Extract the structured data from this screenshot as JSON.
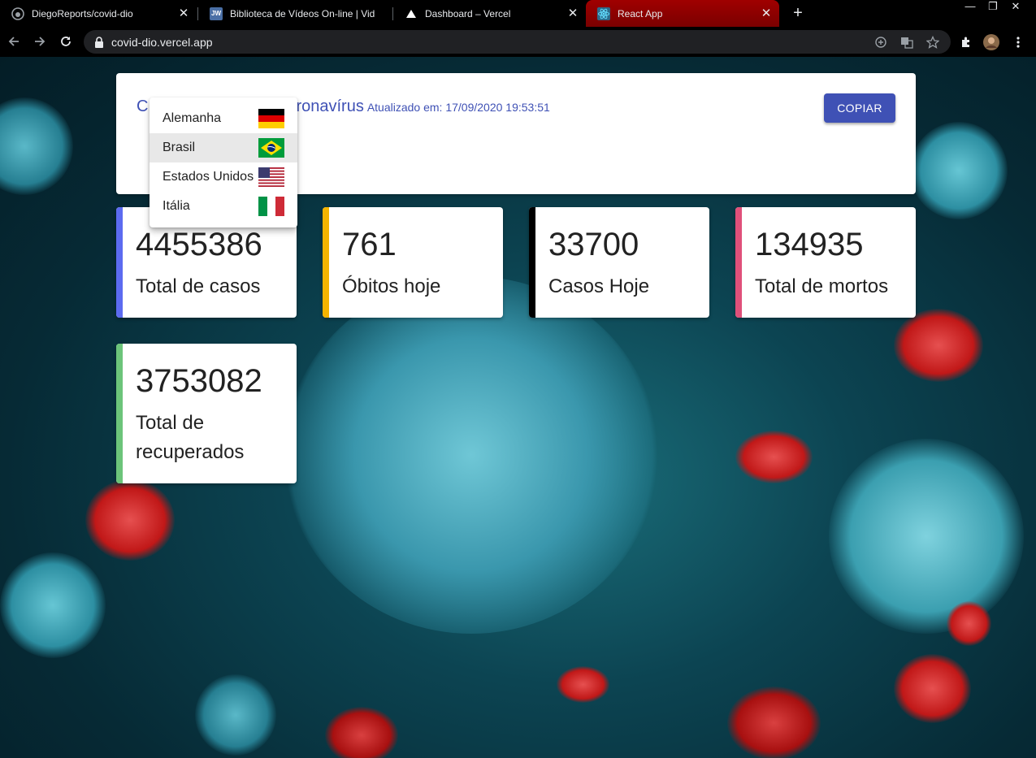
{
  "browser": {
    "tabs": [
      {
        "title": "DiegoReports/covid-dio",
        "icon": "github-icon"
      },
      {
        "title": "Biblioteca de Vídeos On-line | Vid",
        "icon": "jw-icon"
      },
      {
        "title": "Dashboard – Vercel",
        "icon": "vercel-icon"
      },
      {
        "title": "React App",
        "icon": "react-icon",
        "active": true
      }
    ],
    "url": "covid-dio.vercel.app",
    "jw_label": "JW"
  },
  "header": {
    "title_visible_start": "C",
    "title_visible_end": "ronavírus",
    "updated": "Atualizado em: 17/09/2020 19:53:51",
    "copy_label": "COPIAR"
  },
  "dropdown": {
    "options": [
      {
        "label": "Alemanha",
        "flag": "germany-flag"
      },
      {
        "label": "Brasil",
        "flag": "brazil-flag",
        "selected": true
      },
      {
        "label": "Estados Unidos",
        "flag": "usa-flag"
      },
      {
        "label": "Itália",
        "flag": "italy-flag"
      }
    ]
  },
  "stats": [
    {
      "value": "4455386",
      "label": "Total de casos",
      "color": "#5c6bf0"
    },
    {
      "value": "761",
      "label": "Óbitos hoje",
      "color": "#f5b400"
    },
    {
      "value": "33700",
      "label": "Casos Hoje",
      "color": "#000000"
    },
    {
      "value": "134935",
      "label": "Total de mortos",
      "color": "#e0507a"
    },
    {
      "value": "3753082",
      "label": "Total de recuperados",
      "color": "#6cc47a"
    }
  ],
  "colors": {
    "accent": "#3f51b5",
    "active_tab": "#8b0000"
  }
}
